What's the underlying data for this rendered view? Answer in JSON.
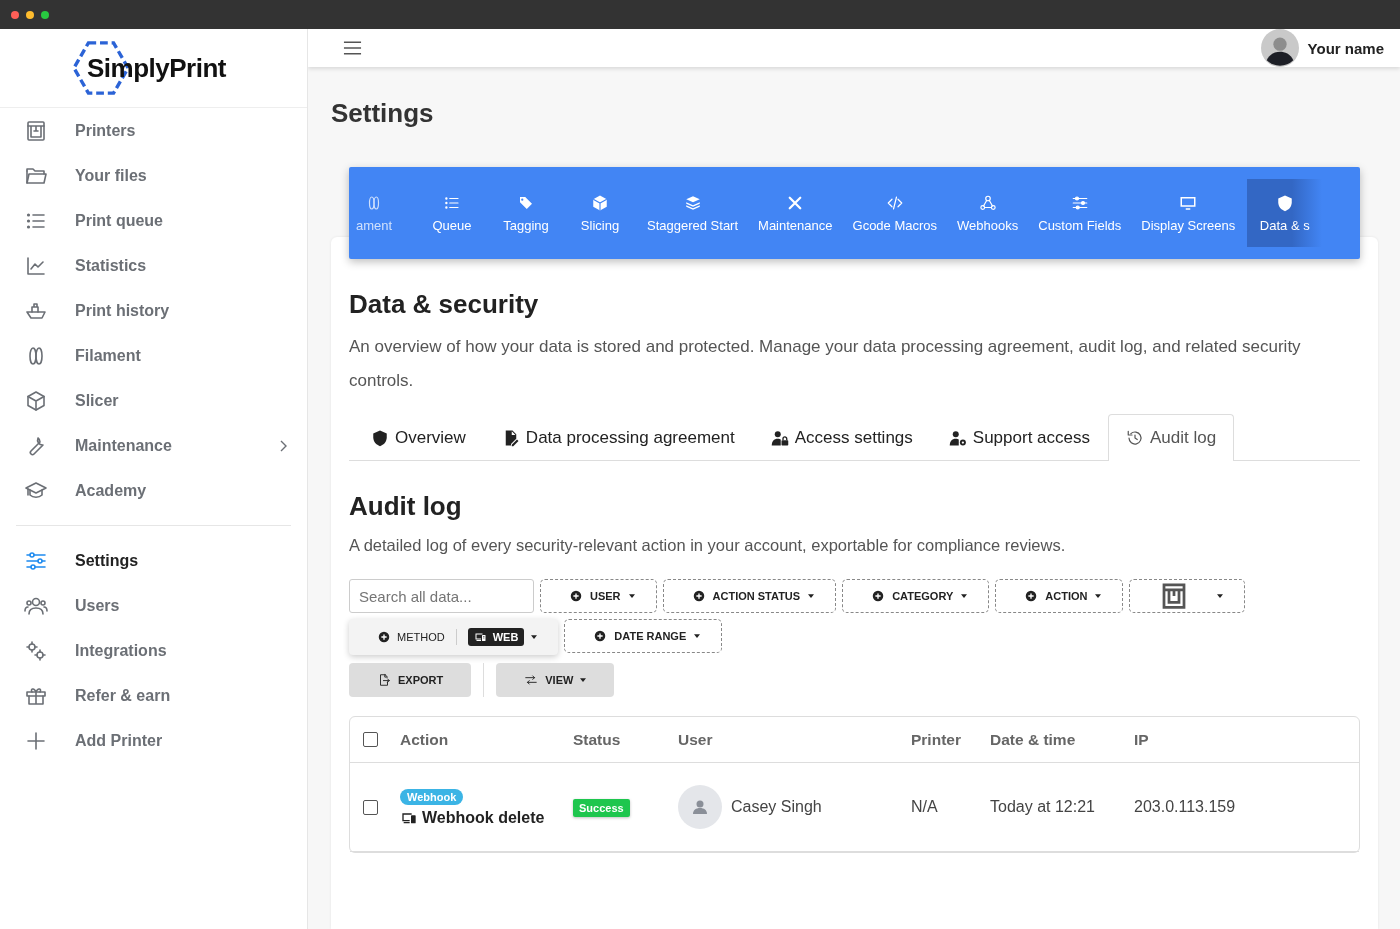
{
  "logo": {
    "text": "SimplyPrint"
  },
  "sidebar": {
    "items": [
      {
        "label": "Printers",
        "selected": false,
        "submenu": false
      },
      {
        "label": "Your files",
        "selected": false,
        "submenu": false
      },
      {
        "label": "Print queue",
        "selected": false,
        "submenu": false
      },
      {
        "label": "Statistics",
        "selected": false,
        "submenu": false
      },
      {
        "label": "Print history",
        "selected": false,
        "submenu": false
      },
      {
        "label": "Filament",
        "selected": false,
        "submenu": false
      },
      {
        "label": "Slicer",
        "selected": false,
        "submenu": false
      },
      {
        "label": "Maintenance",
        "selected": false,
        "submenu": true
      },
      {
        "label": "Academy",
        "selected": false,
        "submenu": false
      }
    ],
    "bottom_items": [
      {
        "label": "Settings",
        "selected": true,
        "submenu": false
      },
      {
        "label": "Users",
        "selected": false,
        "submenu": false
      },
      {
        "label": "Integrations",
        "selected": false,
        "submenu": false
      },
      {
        "label": "Refer & earn",
        "selected": false,
        "submenu": false
      },
      {
        "label": "Add Printer",
        "selected": false,
        "submenu": false
      }
    ]
  },
  "header": {
    "user_name": "Your name"
  },
  "page_title": "Settings",
  "settings_tabs": [
    {
      "label": "ament",
      "selected": false
    },
    {
      "label": "Queue",
      "selected": false
    },
    {
      "label": "Tagging",
      "selected": false
    },
    {
      "label": "Slicing",
      "selected": false
    },
    {
      "label": "Staggered Start",
      "selected": false
    },
    {
      "label": "Maintenance",
      "selected": false
    },
    {
      "label": "Gcode Macros",
      "selected": false
    },
    {
      "label": "Webhooks",
      "selected": false
    },
    {
      "label": "Custom Fields",
      "selected": false
    },
    {
      "label": "Display Screens",
      "selected": false
    },
    {
      "label": "Data & s",
      "selected": true
    }
  ],
  "section": {
    "title": "Data & security",
    "description": "An overview of how your data is stored and protected. Manage your data processing agreement, audit log, and related security controls."
  },
  "sub_tabs": [
    {
      "label": "Overview",
      "selected": false
    },
    {
      "label": "Data processing agreement",
      "selected": false
    },
    {
      "label": "Access settings",
      "selected": false
    },
    {
      "label": "Support access",
      "selected": false
    },
    {
      "label": "Audit log",
      "selected": true
    }
  ],
  "audit": {
    "title": "Audit log",
    "description": "A detailed log of every security-relevant action in your account, exportable for compliance reviews."
  },
  "search": {
    "placeholder": "Search all data..."
  },
  "filters": [
    {
      "kind": "text",
      "label": "USER",
      "active": false
    },
    {
      "kind": "text",
      "label": "ACTION STATUS",
      "active": false
    },
    {
      "kind": "text",
      "label": "CATEGORY",
      "active": false
    },
    {
      "kind": "text",
      "label": "ACTION",
      "active": false
    },
    {
      "kind": "printer",
      "active": false
    },
    {
      "kind": "text",
      "label": "METHOD",
      "active": true,
      "value": "WEB"
    },
    {
      "kind": "text",
      "label": "DATE RANGE",
      "active": false
    }
  ],
  "actions": [
    {
      "kind": "export",
      "label": "EXPORT"
    },
    {
      "kind": "view",
      "label": "VIEW"
    }
  ],
  "table": {
    "columns": [
      "Action",
      "Status",
      "User",
      "Printer",
      "Date & time",
      "IP"
    ],
    "header_checked": false,
    "rows": [
      {
        "checked": false,
        "tag": "Webhook",
        "action": "Webhook delete",
        "status": "Success",
        "user": "Casey Singh",
        "printer": "N/A",
        "date": "Today at 12:21",
        "ip": "203.0.113.159"
      }
    ]
  }
}
